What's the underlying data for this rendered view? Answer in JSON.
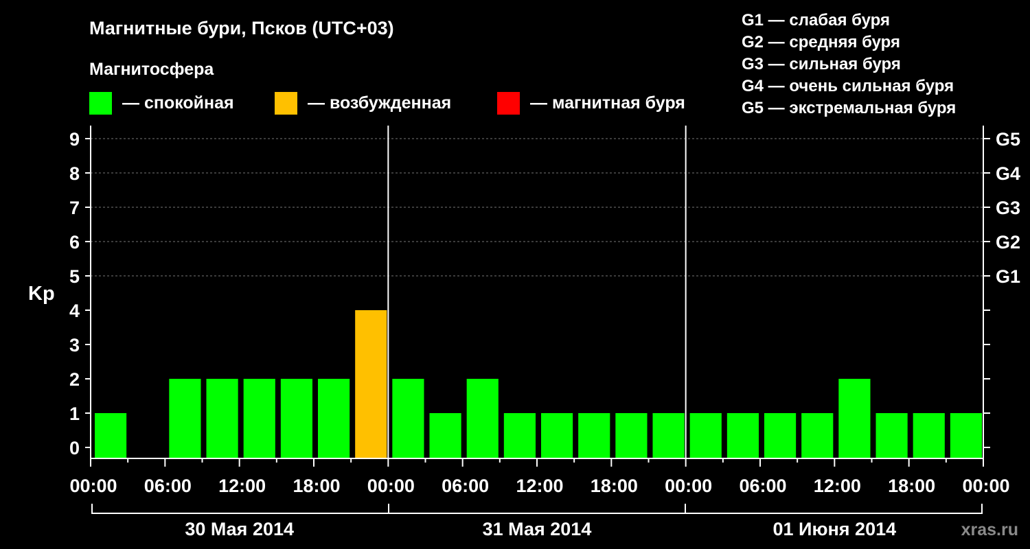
{
  "title": "Магнитные бури, Псков (UTC+03)",
  "legend": {
    "heading": "Магнитосфера",
    "items": [
      {
        "color": "#00ff00",
        "label": "— спокойная"
      },
      {
        "color": "#ffc000",
        "label": "— возбужденная"
      },
      {
        "color": "#ff0000",
        "label": "— магнитная буря"
      }
    ]
  },
  "g_scale": [
    "G1 — слабая буря",
    "G2 — средняя буря",
    "G3 — сильная буря",
    "G4 — очень сильная буря",
    "G5 — экстремальная буря"
  ],
  "watermark": "xras.ru",
  "chart_data": {
    "type": "bar",
    "ylabel": "Kp",
    "ylim": [
      0,
      9
    ],
    "y_ticks": [
      "0",
      "1",
      "2",
      "3",
      "4",
      "5",
      "6",
      "7",
      "8",
      "9"
    ],
    "right_ticks": [
      {
        "kp": 5,
        "label": "G1"
      },
      {
        "kp": 6,
        "label": "G2"
      },
      {
        "kp": 7,
        "label": "G3"
      },
      {
        "kp": 8,
        "label": "G4"
      },
      {
        "kp": 9,
        "label": "G5"
      }
    ],
    "x_ticks": [
      "00:00",
      "06:00",
      "12:00",
      "18:00",
      "00:00",
      "06:00",
      "12:00",
      "18:00",
      "00:00",
      "06:00",
      "12:00",
      "18:00",
      "00:00"
    ],
    "days": [
      "30 Мая 2014",
      "31 Мая 2014",
      "01 Июня 2014"
    ],
    "interval_hours": 3,
    "values": [
      1,
      0,
      2,
      2,
      2,
      2,
      2,
      4,
      2,
      1,
      2,
      1,
      1,
      1,
      1,
      1,
      1,
      1,
      1,
      1,
      2,
      1,
      1,
      1
    ],
    "colors": {
      "quiet": "#00ff00",
      "active": "#ffc000",
      "storm": "#ff0000"
    },
    "grid": true
  }
}
